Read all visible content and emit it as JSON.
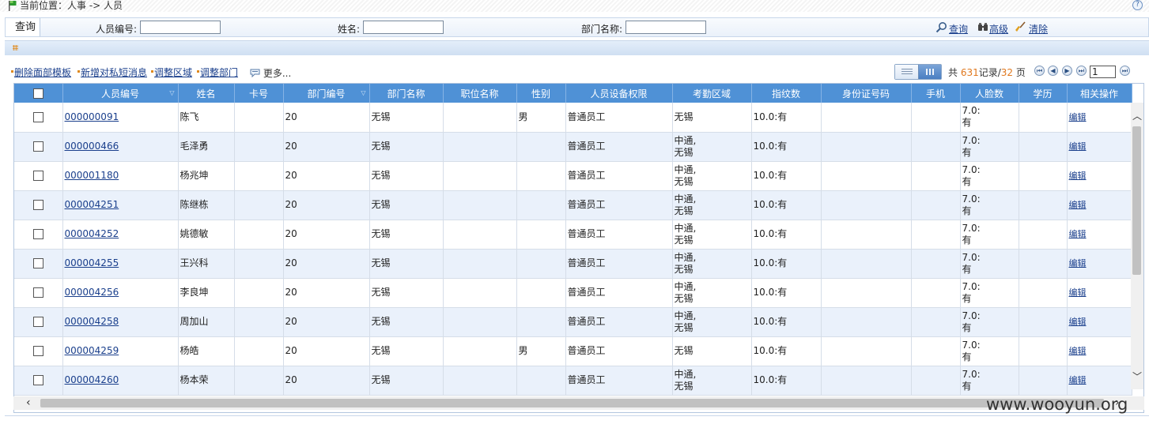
{
  "location": {
    "text": "当前位置：人事 -> 人员"
  },
  "help": "?",
  "query": {
    "tab_label": "查询",
    "fields": [
      {
        "label": "人员编号:",
        "value": ""
      },
      {
        "label": "姓名:",
        "value": ""
      },
      {
        "label": "部门名称:",
        "value": ""
      }
    ],
    "actions": {
      "search": "查询",
      "advanced": "高级",
      "clear": "清除"
    }
  },
  "toolbar": {
    "links": [
      "删除面部模板",
      "新增对私短消息",
      "调整区域",
      "调整部门"
    ],
    "more": "更多..."
  },
  "pager": {
    "prefix": "共",
    "total_records": "631",
    "records_label": "记录/",
    "total_pages": "32",
    "pages_label": "页",
    "current_page": "1"
  },
  "table": {
    "columns": [
      "",
      "人员编号",
      "姓名",
      "卡号",
      "部门编号",
      "部门名称",
      "职位名称",
      "性别",
      "人员设备权限",
      "考勤区域",
      "指纹数",
      "身份证号码",
      "手机",
      "人脸数",
      "学历",
      "相关操作"
    ],
    "edit_label": "编辑",
    "rows": [
      {
        "id": "000000091",
        "name": "陈飞",
        "card": "",
        "dept_no": "20",
        "dept": "无锡",
        "position": "",
        "gender": "男",
        "perm": "普通员工",
        "area1": "无锡",
        "area2": "",
        "fp": "10.0:有",
        "idcard": "",
        "mobile": "",
        "face1": "7.0:",
        "face2": "有",
        "edu": ""
      },
      {
        "id": "000000466",
        "name": "毛泽勇",
        "card": "",
        "dept_no": "20",
        "dept": "无锡",
        "position": "",
        "gender": "",
        "perm": "普通员工",
        "area1": "中通,",
        "area2": "无锡",
        "fp": "10.0:有",
        "idcard": "",
        "mobile": "",
        "face1": "7.0:",
        "face2": "有",
        "edu": ""
      },
      {
        "id": "000001180",
        "name": "杨兆坤",
        "card": "",
        "dept_no": "20",
        "dept": "无锡",
        "position": "",
        "gender": "",
        "perm": "普通员工",
        "area1": "中通,",
        "area2": "无锡",
        "fp": "10.0:有",
        "idcard": "",
        "mobile": "",
        "face1": "7.0:",
        "face2": "有",
        "edu": ""
      },
      {
        "id": "000004251",
        "name": "陈继栋",
        "card": "",
        "dept_no": "20",
        "dept": "无锡",
        "position": "",
        "gender": "",
        "perm": "普通员工",
        "area1": "中通,",
        "area2": "无锡",
        "fp": "10.0:有",
        "idcard": "",
        "mobile": "",
        "face1": "7.0:",
        "face2": "有",
        "edu": ""
      },
      {
        "id": "000004252",
        "name": "姚德敏",
        "card": "",
        "dept_no": "20",
        "dept": "无锡",
        "position": "",
        "gender": "",
        "perm": "普通员工",
        "area1": "中通,",
        "area2": "无锡",
        "fp": "10.0:有",
        "idcard": "",
        "mobile": "",
        "face1": "7.0:",
        "face2": "有",
        "edu": ""
      },
      {
        "id": "000004255",
        "name": "王兴科",
        "card": "",
        "dept_no": "20",
        "dept": "无锡",
        "position": "",
        "gender": "",
        "perm": "普通员工",
        "area1": "中通,",
        "area2": "无锡",
        "fp": "10.0:有",
        "idcard": "",
        "mobile": "",
        "face1": "7.0:",
        "face2": "有",
        "edu": ""
      },
      {
        "id": "000004256",
        "name": "李良坤",
        "card": "",
        "dept_no": "20",
        "dept": "无锡",
        "position": "",
        "gender": "",
        "perm": "普通员工",
        "area1": "中通,",
        "area2": "无锡",
        "fp": "10.0:有",
        "idcard": "",
        "mobile": "",
        "face1": "7.0:",
        "face2": "有",
        "edu": ""
      },
      {
        "id": "000004258",
        "name": "周加山",
        "card": "",
        "dept_no": "20",
        "dept": "无锡",
        "position": "",
        "gender": "",
        "perm": "普通员工",
        "area1": "中通,",
        "area2": "无锡",
        "fp": "10.0:有",
        "idcard": "",
        "mobile": "",
        "face1": "7.0:",
        "face2": "有",
        "edu": ""
      },
      {
        "id": "000004259",
        "name": "杨皓",
        "card": "",
        "dept_no": "20",
        "dept": "无锡",
        "position": "",
        "gender": "男",
        "perm": "普通员工",
        "area1": "无锡",
        "area2": "",
        "fp": "10.0:有",
        "idcard": "",
        "mobile": "",
        "face1": "7.0:",
        "face2": "有",
        "edu": ""
      },
      {
        "id": "000004260",
        "name": "杨本荣",
        "card": "",
        "dept_no": "20",
        "dept": "无锡",
        "position": "",
        "gender": "",
        "perm": "普通员工",
        "area1": "中通,",
        "area2": "无锡",
        "fp": "10.0:有",
        "idcard": "",
        "mobile": "",
        "face1": "7.0:",
        "face2": "有",
        "edu": ""
      }
    ]
  },
  "watermark": "www.wooyun.org",
  "colors": {
    "header_bg": "#4f91d6",
    "link": "#1a3f8c",
    "accent_orange": "#e0781e",
    "row_alt": "#eaf1fb"
  }
}
